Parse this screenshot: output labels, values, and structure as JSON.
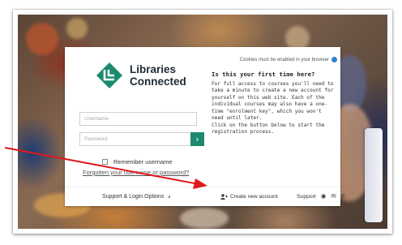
{
  "logo": {
    "line1": "Libraries",
    "line2": "Connected",
    "colors": {
      "diamond": "#1c8a6e",
      "text": "#1f2a36"
    }
  },
  "login": {
    "username_placeholder": "Username",
    "password_placeholder": "Password",
    "go_icon": "chevron-right",
    "remember_label": "Remember username",
    "forgot_link": "Forgotten your username or password?"
  },
  "info": {
    "cookies_notice": "Cookies must be enabled in your browser",
    "heading": "Is this your first time here?",
    "paragraph1": "For full access to courses you'll need to take a minute to create a new account for yourself on this web site. Each of the individual courses may also have a one-time \"enrolment key\", which you won't need until later.",
    "paragraph2": "Click on the button below to start the registration process."
  },
  "footer": {
    "support_login_options": "Support & Login Options",
    "create_account": "Create new account",
    "support": "Support",
    "icons": [
      "help-icon",
      "mail-icon",
      "phone-icon"
    ]
  },
  "annotation": {
    "arrow_color": "#e0191b"
  }
}
